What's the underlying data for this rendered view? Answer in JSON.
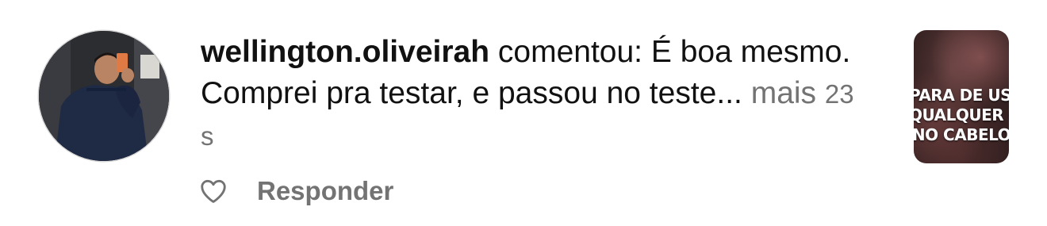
{
  "comment": {
    "username": "wellington.oliveirah",
    "action": "comentou:",
    "text": "É boa mesmo. Comprei pra testar, e passou no teste...",
    "more_label": "mais",
    "timestamp": "23 s"
  },
  "actions": {
    "like_icon": "heart-outline-icon",
    "reply_label": "Responder"
  },
  "thumbnail": {
    "caption_lines": [
      "PARA DE USAR",
      "QUALQUER COISA",
      "NO CABELO"
    ]
  },
  "colors": {
    "text": "#111111",
    "secondary": "#737373",
    "background": "#ffffff"
  }
}
